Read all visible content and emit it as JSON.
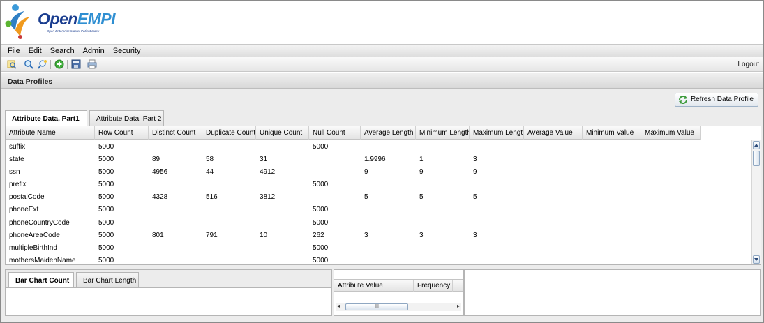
{
  "app": {
    "logo_open": "Open",
    "logo_empi": "EMPI",
    "logo_subtitle": "Open Enterprise Master Patient Index"
  },
  "menu": [
    "File",
    "Edit",
    "Search",
    "Admin",
    "Security"
  ],
  "toolbar": {
    "icons": [
      "search-record-icon",
      "zoom-search-icon",
      "advanced-search-icon",
      "add-record-icon",
      "save-icon",
      "print-icon"
    ],
    "logout_label": "Logout"
  },
  "panel": {
    "title": "Data Profiles",
    "refresh_label": "Refresh Data Profile"
  },
  "top_tabs": [
    "Attribute Data, Part1",
    "Attribute Data, Part 2"
  ],
  "grid": {
    "columns": [
      "Attribute Name",
      "Row Count",
      "Distinct Count",
      "Duplicate Count",
      "Unique Count",
      "Null Count",
      "Average Length",
      "Minimum Length",
      "Maximum Length",
      "Average Value",
      "Minimum Value",
      "Maximum Value"
    ],
    "rows": [
      [
        "suffix",
        "5000",
        "",
        "",
        "",
        "5000",
        "",
        "",
        "",
        "",
        "",
        ""
      ],
      [
        "state",
        "5000",
        "89",
        "58",
        "31",
        "",
        "1.9996",
        "1",
        "3",
        "",
        "",
        ""
      ],
      [
        "ssn",
        "5000",
        "4956",
        "44",
        "4912",
        "",
        "9",
        "9",
        "9",
        "",
        "",
        ""
      ],
      [
        "prefix",
        "5000",
        "",
        "",
        "",
        "5000",
        "",
        "",
        "",
        "",
        "",
        ""
      ],
      [
        "postalCode",
        "5000",
        "4328",
        "516",
        "3812",
        "",
        "5",
        "5",
        "5",
        "",
        "",
        ""
      ],
      [
        "phoneExt",
        "5000",
        "",
        "",
        "",
        "5000",
        "",
        "",
        "",
        "",
        "",
        ""
      ],
      [
        "phoneCountryCode",
        "5000",
        "",
        "",
        "",
        "5000",
        "",
        "",
        "",
        "",
        "",
        ""
      ],
      [
        "phoneAreaCode",
        "5000",
        "801",
        "791",
        "10",
        "262",
        "3",
        "3",
        "3",
        "",
        "",
        ""
      ],
      [
        "multipleBirthInd",
        "5000",
        "",
        "",
        "",
        "5000",
        "",
        "",
        "",
        "",
        "",
        ""
      ],
      [
        "mothersMaidenName",
        "5000",
        "",
        "",
        "",
        "5000",
        "",
        "",
        "",
        "",
        "",
        ""
      ]
    ]
  },
  "bottom_tabs": [
    "Bar Chart Count",
    "Bar Chart Length"
  ],
  "frequency_table": {
    "columns": [
      "Attribute Value",
      "Frequency"
    ],
    "scroll_thumb_label": "III"
  }
}
